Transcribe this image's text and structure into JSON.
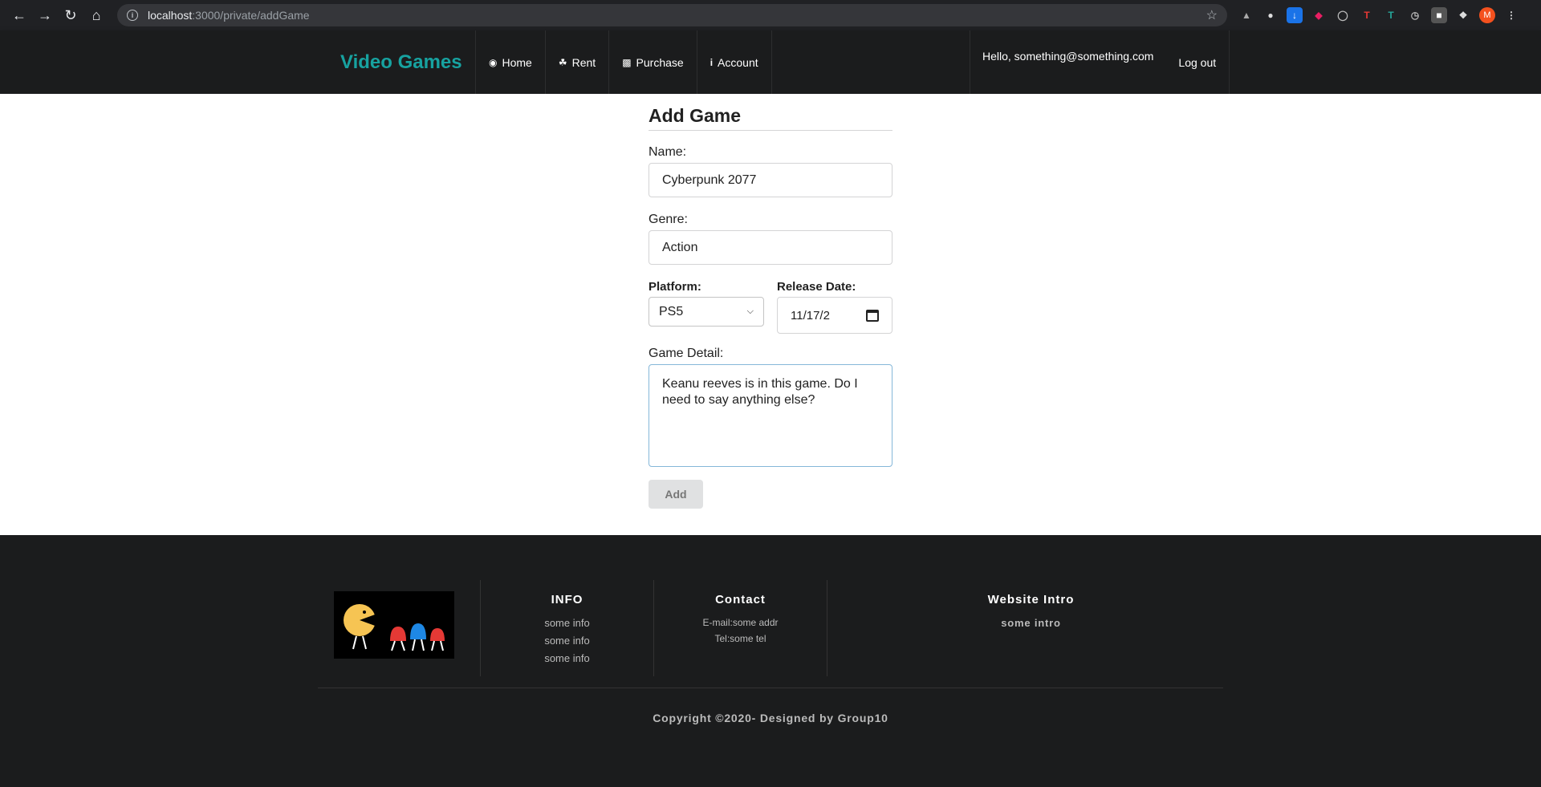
{
  "browser": {
    "url_host": "localhost",
    "url_path": ":3000/private/addGame",
    "avatar_letter": "M"
  },
  "navbar": {
    "brand": "Video Games",
    "items": [
      {
        "label": "Home",
        "icon": "gamepad-icon"
      },
      {
        "label": "Rent",
        "icon": "handshake-icon"
      },
      {
        "label": "Purchase",
        "icon": "gift-icon"
      },
      {
        "label": "Account",
        "icon": "info-icon"
      }
    ],
    "greeting": "Hello, something@something.com",
    "logout": "Log out"
  },
  "form": {
    "title": "Add Game",
    "name_label": "Name:",
    "name_value": "Cyberpunk 2077",
    "genre_label": "Genre:",
    "genre_value": "Action",
    "platform_label": "Platform:",
    "platform_value": "PS5",
    "release_label": "Release Date:",
    "release_value": "11/17/2",
    "detail_label": "Game Detail:",
    "detail_value": "Keanu reeves is in this game. Do I need to say anything else?",
    "add_label": "Add"
  },
  "footer": {
    "info_title": "INFO",
    "info_items": [
      "some info",
      "some info",
      "some info"
    ],
    "contact_title": "Contact",
    "contact_email": "E-mail:some addr",
    "contact_tel": "Tel:some tel",
    "intro_title": "Website Intro",
    "intro_text": "some intro",
    "copyright": "Copyright ©2020- Designed by Group10"
  },
  "colors": {
    "brand": "#17a2a0",
    "background": "#1b1c1d"
  }
}
